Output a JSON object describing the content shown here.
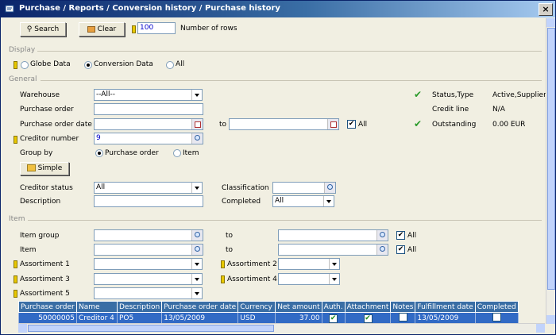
{
  "title": "Purchase / Reports / Conversion history / Purchase history",
  "toolbar": {
    "search": "Search",
    "clear": "Clear",
    "rows_value": "100",
    "rows_label": "Number of rows"
  },
  "display": {
    "label": "Display",
    "opt1": "Globe Data",
    "opt2": "Conversion Data",
    "opt3": "All"
  },
  "general": {
    "label": "General",
    "warehouse_label": "Warehouse",
    "warehouse_value": "--All--",
    "po_label": "Purchase order",
    "po_date_label": "Purchase order date",
    "to": "to",
    "all": "All",
    "creditor_number_label": "Creditor number",
    "creditor_number_value": "9",
    "group_by_label": "Group by",
    "group_opt1": "Purchase order",
    "group_opt2": "Item",
    "simple": "Simple",
    "creditor_status_label": "Creditor status",
    "creditor_status_value": "All",
    "description_label": "Description",
    "classification_label": "Classification",
    "completed_label": "Completed",
    "completed_value": "All"
  },
  "info": {
    "status_label": "Status,Type",
    "status_value": "Active,Supplier",
    "credit_label": "Credit line",
    "credit_value": "N/A",
    "outstanding_label": "Outstanding",
    "outstanding_value": "0.00 EUR"
  },
  "item": {
    "label": "Item",
    "item_group_label": "Item group",
    "to": "to",
    "all": "All",
    "item_label": "Item",
    "a1": "Assortiment 1",
    "a2": "Assortiment 2",
    "a3": "Assortiment 3",
    "a4": "Assortiment 4",
    "a5": "Assortiment 5"
  },
  "grid": {
    "headers": [
      "Purchase order",
      "Name",
      "Description",
      "Purchase order date",
      "Currency",
      "Net amount",
      "Auth.",
      "Attachment",
      "Notes",
      "Fulfillment date",
      "Completed"
    ],
    "row": {
      "po": "50000005",
      "name": "Creditor 4",
      "desc": "PO5",
      "date": "13/05/2009",
      "currency": "USD",
      "net": "37.00",
      "fulfil": "13/05/2009"
    }
  }
}
